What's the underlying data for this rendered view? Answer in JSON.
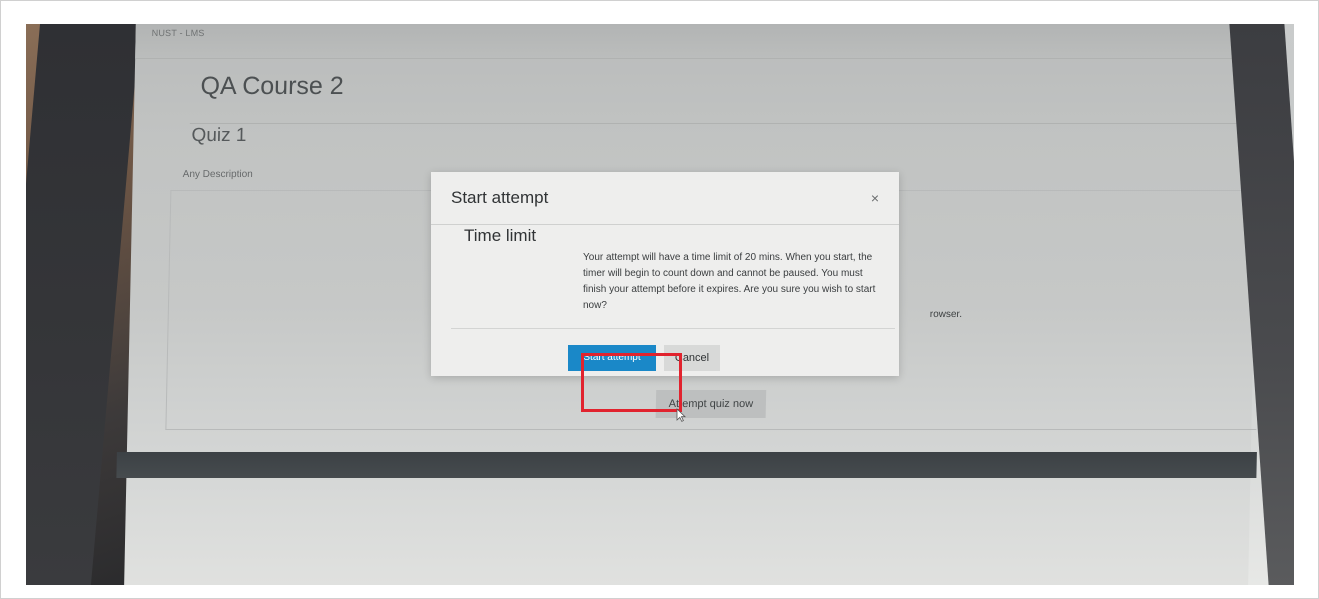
{
  "site": {
    "name": "NUST - LMS"
  },
  "course": {
    "title": "QA Course 2"
  },
  "quiz": {
    "title": "Quiz 1",
    "description": "Any Description",
    "browser_fragment": "rowser.",
    "attempt_button_label": "Attempt quiz now"
  },
  "modal": {
    "title": "Start attempt",
    "close_symbol": "×",
    "subtitle": "Time limit",
    "message": "Your attempt will have a time limit of 20 mins. When you start, the timer will begin to count down and cannot be paused. You must finish your attempt before it expires. Are you sure you wish to start now?",
    "primary_button": "Start attempt",
    "secondary_button": "Cancel"
  },
  "colors": {
    "primary_button": "#1a88c8",
    "highlight": "#e1232e"
  },
  "icons": {
    "close": "close-icon",
    "cursor": "mouse-cursor-icon"
  }
}
